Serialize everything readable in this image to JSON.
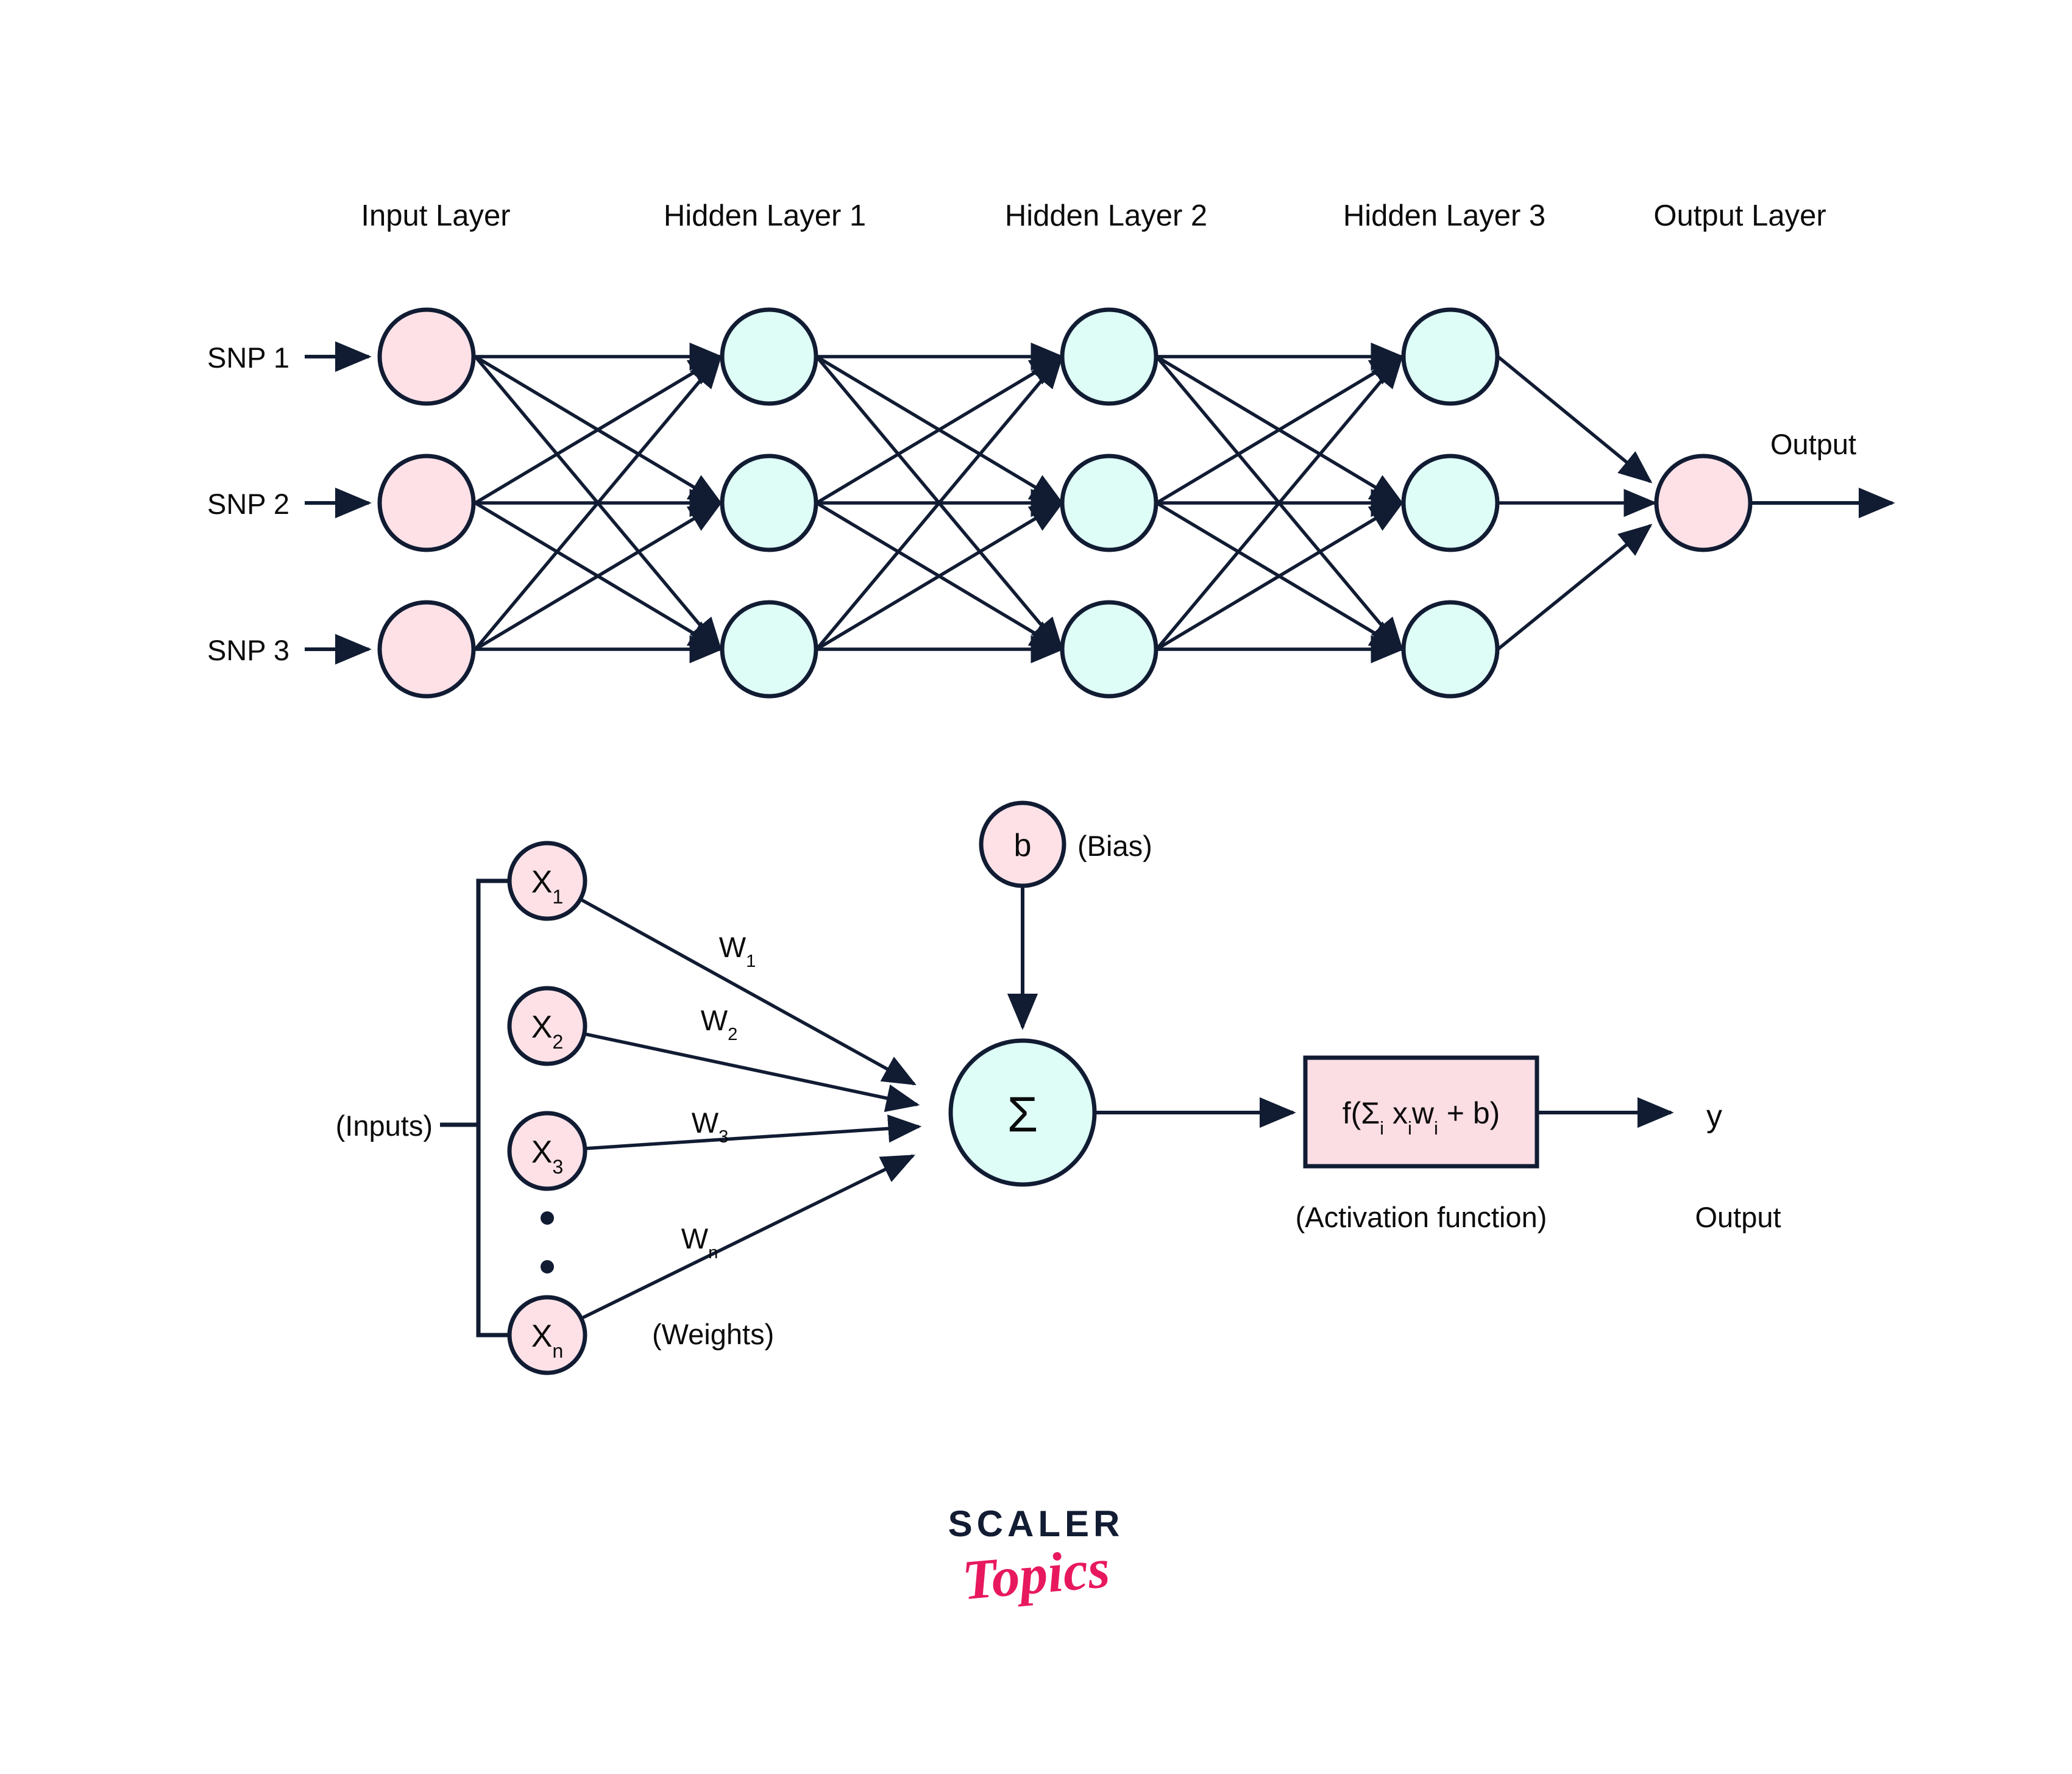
{
  "figure": {
    "title": "Neural network architecture and artificial neuron (perceptron) diagram",
    "colors": {
      "input_node_fill": "#fde1e7",
      "hidden_node_fill": "#ddfdf6",
      "output_node_fill": "#fde1e7",
      "stroke": "#111c33",
      "activation_box_fill": "#fbdde4",
      "background": "#ffffff",
      "logo_dark": "#121c33",
      "logo_pink": "#e8185f"
    }
  },
  "network": {
    "layer_labels": [
      "Input Layer",
      "Hidden Layer 1",
      "Hidden Layer 2",
      "Hidden Layer 3",
      "Output Layer"
    ],
    "input_labels": [
      "SNP 1",
      "SNP 2",
      "SNP 3"
    ],
    "output_label": "Output",
    "layer_sizes": [
      3,
      3,
      3,
      3,
      1
    ],
    "connectivity": "fully-connected"
  },
  "neuron": {
    "inputs_bracket_label": "(Inputs)",
    "input_nodes": [
      {
        "base": "X",
        "sub": "1"
      },
      {
        "base": "X",
        "sub": "2"
      },
      {
        "base": "X",
        "sub": "3"
      },
      {
        "base": "X",
        "sub": "n"
      }
    ],
    "weight_labels": [
      {
        "base": "W",
        "sub": "1"
      },
      {
        "base": "W",
        "sub": "2"
      },
      {
        "base": "W",
        "sub": "3"
      },
      {
        "base": "W",
        "sub": "n"
      }
    ],
    "weights_caption": "(Weights)",
    "bias_symbol": "b",
    "bias_caption": "(Bias)",
    "summation_symbol": "Σ",
    "activation_formula_parts": {
      "prefix": "f(Σ",
      "sub1": "i",
      "mid": " x",
      "sub2": "i",
      "mid2": "w",
      "sub3": "i",
      "suffix": " + b)"
    },
    "activation_formula_plain": "f(Σi xiwi + b)",
    "activation_caption": "(Activation function)",
    "output_symbol": "y",
    "output_caption": "Output",
    "ellipsis_dots": 2
  },
  "logo": {
    "word_top": "SCALER",
    "word_bottom": "Topics"
  }
}
